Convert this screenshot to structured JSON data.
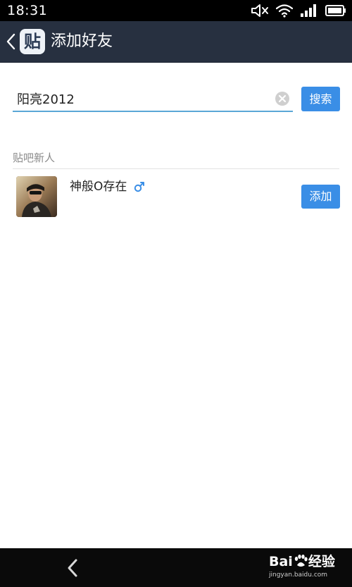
{
  "status_bar": {
    "time": "18:31",
    "icons": [
      "mute-icon",
      "wifi-icon",
      "signal-icon",
      "battery-icon"
    ]
  },
  "header": {
    "logo_text": "贴",
    "title": "添加好友"
  },
  "search": {
    "value": "阳亮2012",
    "button_label": "搜索"
  },
  "section": {
    "title": "贴吧新人"
  },
  "users": [
    {
      "name": "神般O存在",
      "gender": "♂",
      "action_label": "添加"
    }
  ],
  "watermark": {
    "logo_prefix": "Bai",
    "logo_suffix": "经验",
    "url": "jingyan.baidu.com"
  },
  "colors": {
    "header_bg": "#273040",
    "accent_blue": "#3a8ee6",
    "input_underline": "#5aa7d6",
    "status_bar_bg": "#000000",
    "nav_bar_bg": "#0a0a0a"
  }
}
